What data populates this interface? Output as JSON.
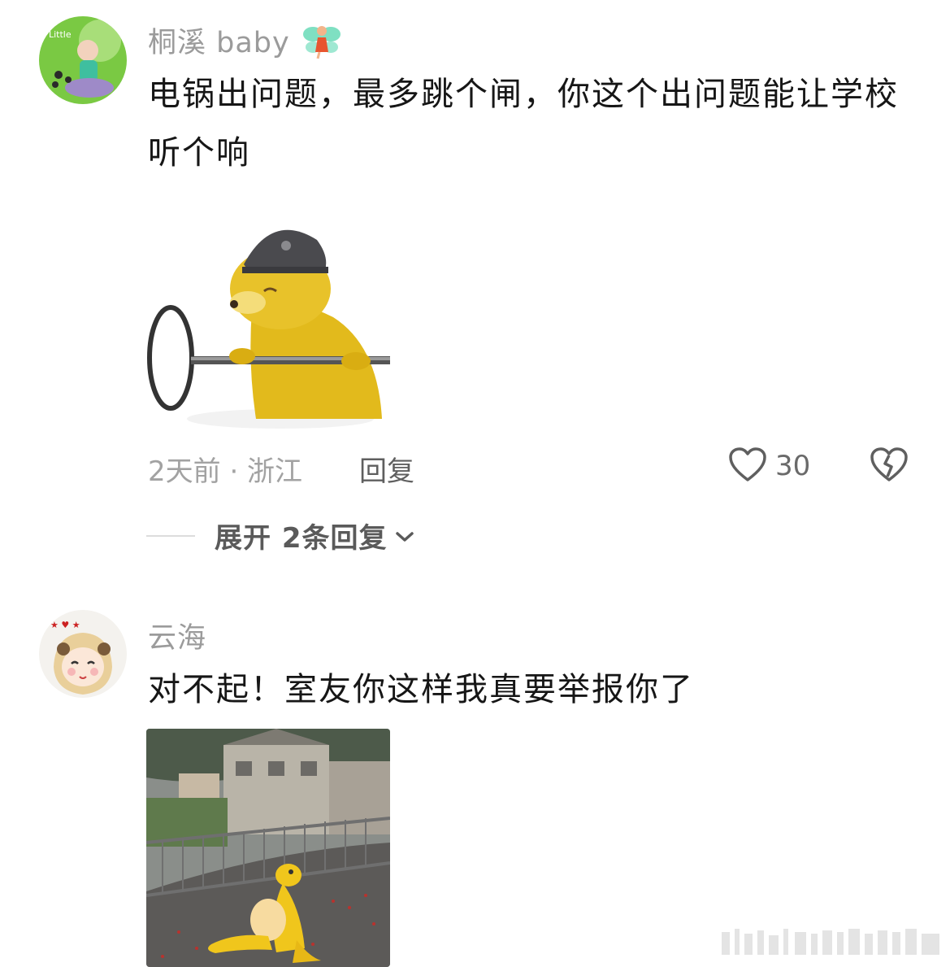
{
  "comments": [
    {
      "username": "桐溪 baby",
      "username_icon": "fairy-emoji-icon",
      "text": "电锅出问题，最多跳个闸，你这个出问题能让学校听个响",
      "sticker": "doge-helmet-sticker",
      "meta": "2天前 · 浙江",
      "reply_label": "回复",
      "like_count": "30",
      "expand_label": "展开 2条回复"
    },
    {
      "username": "云海",
      "text": "对不起！室友你这样我真要举报你了",
      "sticker": "yellow-toy-street-sticker"
    }
  ],
  "colors": {
    "username": "#9b9b9b",
    "meta": "#a2a2a2",
    "text": "#161616"
  }
}
